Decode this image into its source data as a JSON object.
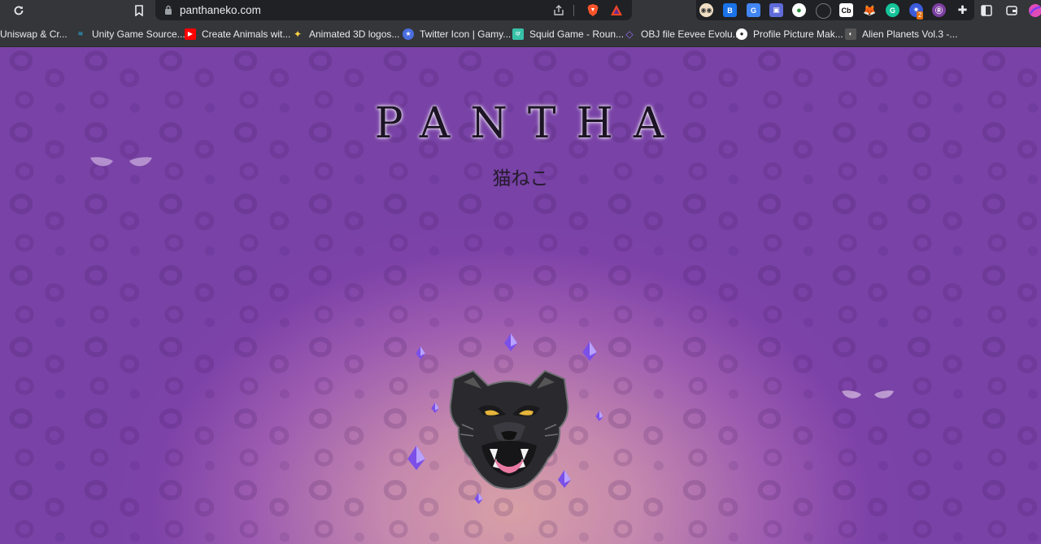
{
  "browser": {
    "url": "panthaneko.com",
    "bookmarks": [
      {
        "label": "Uniswap & Cr...",
        "icon": "uniswap-icon"
      },
      {
        "label": "Unity Game Source...",
        "icon": "unity-icon"
      },
      {
        "label": "Create Animals wit...",
        "icon": "youtube-icon"
      },
      {
        "label": "Animated 3D logos...",
        "icon": "sparkle-icon"
      },
      {
        "label": "Twitter Icon | Gamy...",
        "icon": "star-icon"
      },
      {
        "label": "Squid Game - Roun...",
        "icon": "qr-icon"
      },
      {
        "label": "OBJ file Eevee Evolu...",
        "icon": "obj-icon"
      },
      {
        "label": "Profile Picture Mak...",
        "icon": "profile-icon"
      },
      {
        "label": "Alien Planets Vol.3 -...",
        "icon": "alien-icon"
      }
    ],
    "extensions": {
      "cb_label": "Cb",
      "badge_count": "2"
    },
    "colors": {
      "chrome": "#35363a",
      "omnibox": "#202124",
      "text": "#e8eaed"
    }
  },
  "page": {
    "title": "PANTHA",
    "subtitle": "猫ねこ",
    "colors": {
      "background_outer": "#7842a6",
      "background_center": "#d8a0a6",
      "gem": "#8a5cf0"
    }
  }
}
